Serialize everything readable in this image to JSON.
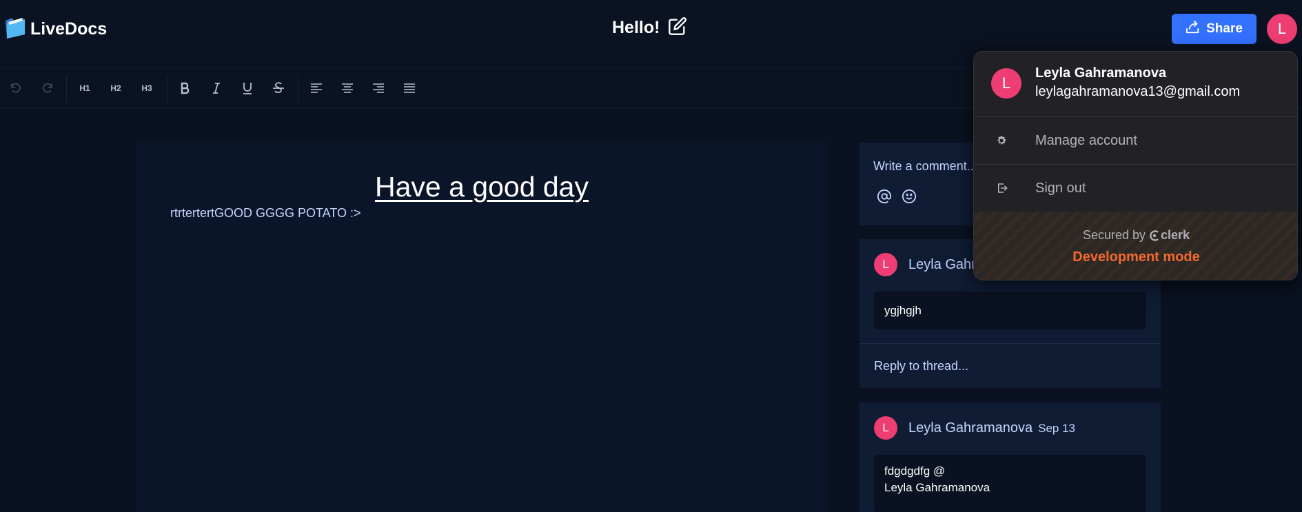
{
  "app": {
    "name": "LiveDocs"
  },
  "document": {
    "title": "Hello!"
  },
  "header": {
    "share_label": "Share",
    "avatar_initial": "L"
  },
  "toolbar": {
    "h1": "H1",
    "h2": "H2",
    "h3": "H3"
  },
  "editor": {
    "heading": "Have a good day",
    "paragraph": "rtrtertertGOOD GGGG POTATO :>"
  },
  "comments": {
    "composer_placeholder": "Write a comment...",
    "threads": [
      {
        "avatar_initial": "L",
        "author": "Leyla Gahramanova",
        "date": "",
        "body": "ygjhgjh",
        "reply_placeholder": "Reply to thread..."
      },
      {
        "avatar_initial": "L",
        "author": "Leyla Gahramanova",
        "date": "Sep 13",
        "body_line1": "fdgdgdfg @",
        "body_line2": "Leyla Gahramanova"
      }
    ]
  },
  "user_menu": {
    "avatar_initial": "L",
    "name": "Leyla Gahramanova",
    "email": "leylagahramanova13@gmail.com",
    "manage_account": "Manage account",
    "sign_out": "Sign out",
    "secured_by": "Secured by",
    "brand": "clerk",
    "dev_mode": "Development mode"
  },
  "colors": {
    "background": "#0a1120",
    "share_button": "#3371ff",
    "avatar": "#ee3d72",
    "dev_mode": "#f2692f"
  }
}
